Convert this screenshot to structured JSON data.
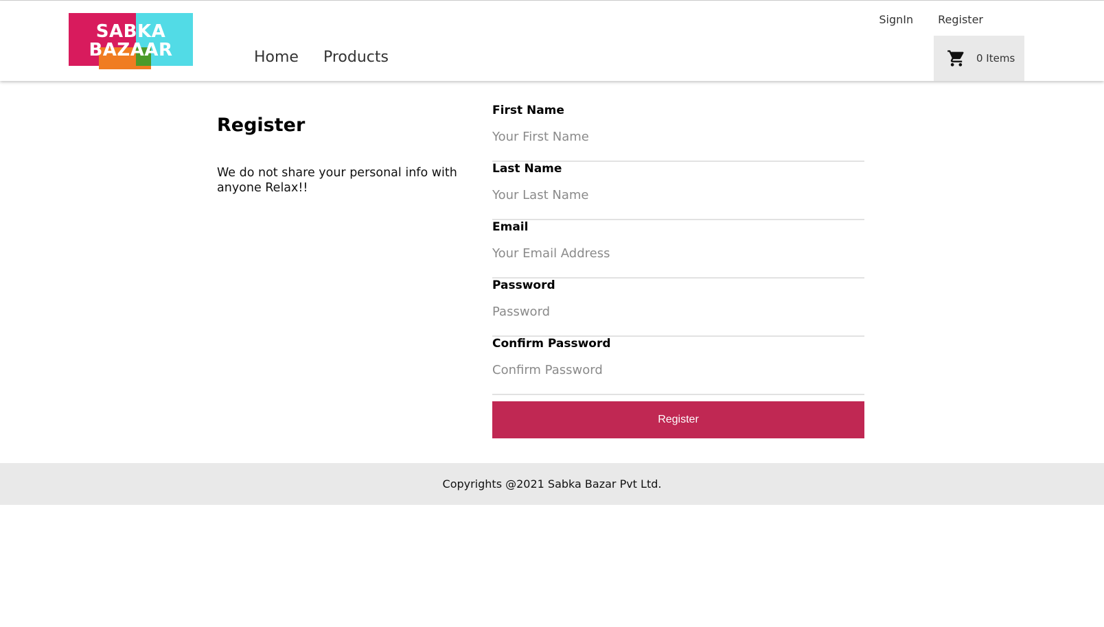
{
  "brand": {
    "logo_line1": "SABKA",
    "logo_line2": "BAZAAR",
    "colors": {
      "pink": "#d81b5d",
      "cyan": "#52dbe6",
      "orange": "#f07c21",
      "green": "#4c9a2a"
    }
  },
  "nav": {
    "items": [
      "Home",
      "Products"
    ]
  },
  "auth": {
    "signin": "SignIn",
    "register": "Register"
  },
  "cart": {
    "icon": "shopping-cart-icon",
    "count_label": "0 Items"
  },
  "intro": {
    "title": "Register",
    "description": "We do not share your personal info with anyone Relax!!"
  },
  "form": {
    "fields": [
      {
        "label": "First Name",
        "placeholder": "Your First Name",
        "value": ""
      },
      {
        "label": "Last Name",
        "placeholder": "Your Last Name",
        "value": ""
      },
      {
        "label": "Email",
        "placeholder": "Your Email Address",
        "value": ""
      },
      {
        "label": "Password",
        "placeholder": "Password",
        "value": ""
      },
      {
        "label": "Confirm Password",
        "placeholder": "Confirm Password",
        "value": ""
      }
    ],
    "submit_label": "Register",
    "submit_color": "#c02853"
  },
  "footer": {
    "copyright": "Copyrights @2021 Sabka Bazar Pvt Ltd."
  }
}
